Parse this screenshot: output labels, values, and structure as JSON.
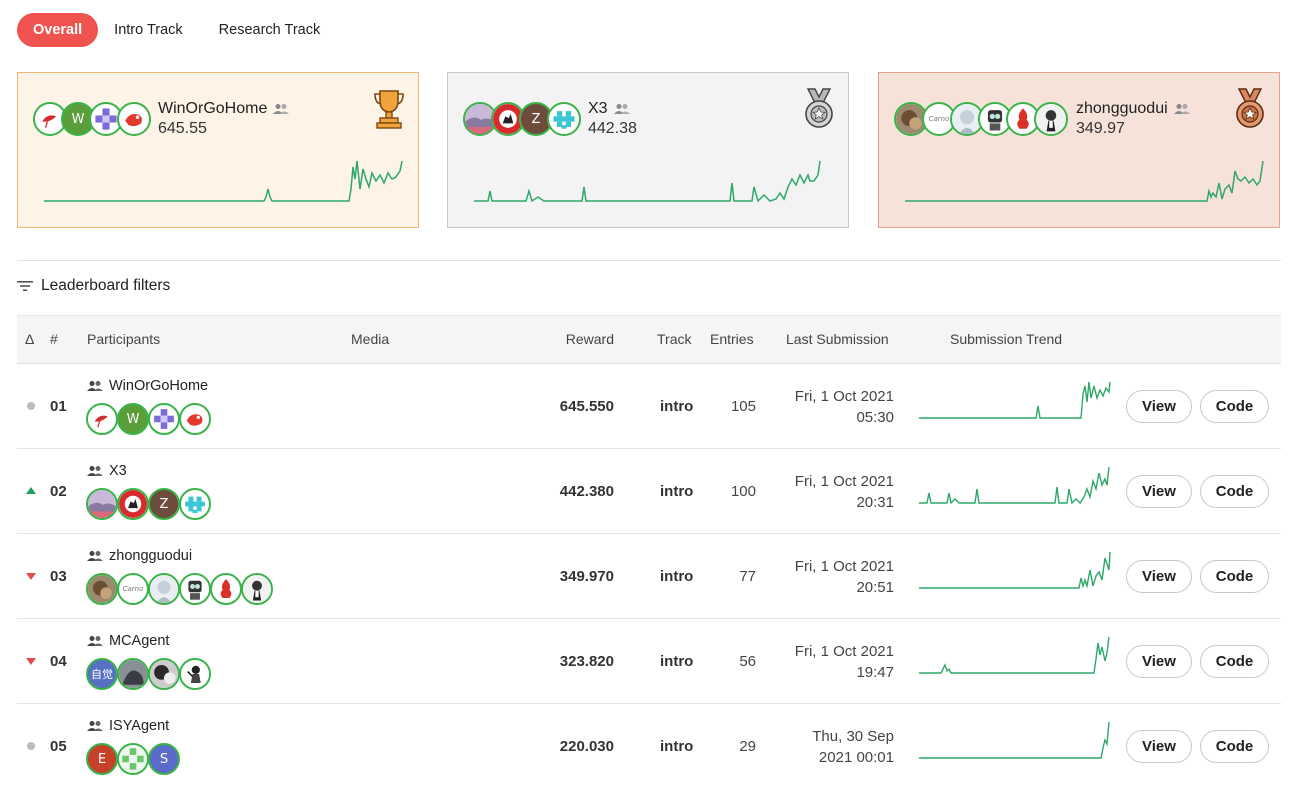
{
  "tabs": [
    {
      "label": "Overall",
      "active": true
    },
    {
      "label": "Intro Track",
      "active": false
    },
    {
      "label": "Research Track",
      "active": false
    }
  ],
  "podium": [
    {
      "place": "gold",
      "name": "WinOrGoHome",
      "score": "645.55",
      "icon": "trophy-icon"
    },
    {
      "place": "silver",
      "name": "X3",
      "score": "442.38",
      "icon": "silver-medal-icon"
    },
    {
      "place": "bronze",
      "name": "zhongguodui",
      "score": "349.97",
      "icon": "bronze-medal-icon"
    }
  ],
  "filters_label": "Leaderboard filters",
  "columns": {
    "delta": "Δ",
    "rank": "#",
    "participants": "Participants",
    "media": "Media",
    "reward": "Reward",
    "track": "Track",
    "entries": "Entries",
    "last_submission": "Last Submission",
    "trend": "Submission Trend"
  },
  "rows": [
    {
      "delta": "same",
      "rank": "01",
      "name": "WinOrGoHome",
      "reward": "645.550",
      "track": "intro",
      "entries": "105",
      "date": "Fri, 1 Oct 2021",
      "time": "05:30",
      "view": "View",
      "code": "Code"
    },
    {
      "delta": "up",
      "rank": "02",
      "name": "X3",
      "reward": "442.380",
      "track": "intro",
      "entries": "100",
      "date": "Fri, 1 Oct 2021",
      "time": "20:31",
      "view": "View",
      "code": "Code"
    },
    {
      "delta": "down",
      "rank": "03",
      "name": "zhongguodui",
      "reward": "349.970",
      "track": "intro",
      "entries": "77",
      "date": "Fri, 1 Oct 2021",
      "time": "20:51",
      "view": "View",
      "code": "Code"
    },
    {
      "delta": "down",
      "rank": "04",
      "name": "MCAgent",
      "reward": "323.820",
      "track": "intro",
      "entries": "56",
      "date": "Fri, 1 Oct 2021",
      "time": "19:47",
      "view": "View",
      "code": "Code"
    },
    {
      "delta": "same",
      "rank": "05",
      "name": "ISYAgent",
      "reward": "220.030",
      "track": "intro",
      "entries": "29",
      "date": "Thu, 30 Sep",
      "time": "2021 00:01",
      "view": "View",
      "code": "Code"
    }
  ],
  "avatar_text": {
    "w": "W",
    "z": "Z",
    "carno": "Carno",
    "zijue": "自觉",
    "e": "E",
    "s": "S"
  },
  "colors": {
    "accent": "#f0524f",
    "trend": "#2ea86a",
    "avatar_ring": "#3bb34a",
    "up": "#1fa05a",
    "down": "#e34c4c",
    "same": "#bbbbbb"
  }
}
